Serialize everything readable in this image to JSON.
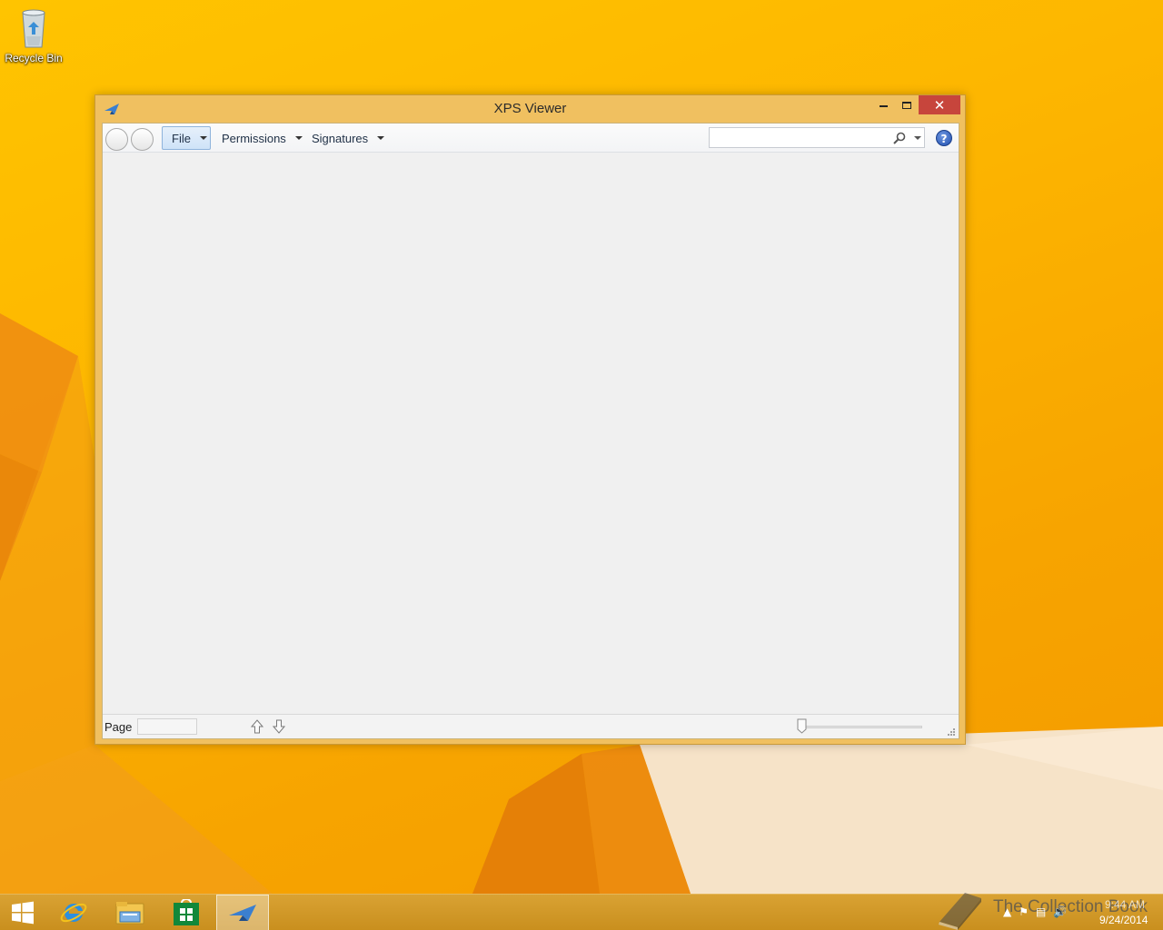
{
  "desktop": {
    "icons": [
      {
        "label": "Recycle Bin",
        "icon": "recycle-bin-icon"
      }
    ]
  },
  "window": {
    "title": "XPS Viewer",
    "app_icon": "xps-viewer-icon",
    "caption": {
      "minimize": "minimize-icon",
      "maximize": "maximize-icon",
      "close": "✕"
    }
  },
  "toolbar": {
    "menus": [
      {
        "label": "File",
        "active": true
      },
      {
        "label": "Permissions",
        "active": false
      },
      {
        "label": "Signatures",
        "active": false
      }
    ],
    "search": {
      "value": "",
      "placeholder": ""
    },
    "help_label": "?"
  },
  "statusbar": {
    "page_label": "Page",
    "page_value": "",
    "zoom_level": 0
  },
  "taskbar": {
    "items": [
      {
        "name": "start",
        "icon": "windows-logo-icon"
      },
      {
        "name": "internet-explorer",
        "icon": "internet-explorer-icon"
      },
      {
        "name": "file-explorer",
        "icon": "file-explorer-icon"
      },
      {
        "name": "store",
        "icon": "store-icon"
      },
      {
        "name": "xps-viewer",
        "icon": "xps-viewer-icon",
        "active": true
      }
    ],
    "clock": {
      "time": "9:44 AM",
      "date": "9/24/2014"
    }
  },
  "watermark": {
    "text": "The Collection Book"
  },
  "colors": {
    "desktop": "#fdb600",
    "window_frame": "#f0c060",
    "close_button": "#c7453c",
    "menu_active": "#cfe3f8",
    "taskbar": "#d9a233"
  }
}
